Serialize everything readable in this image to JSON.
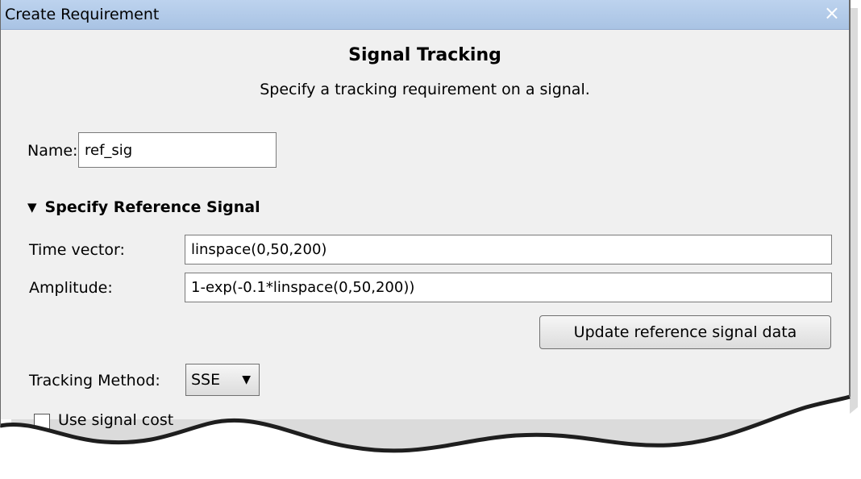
{
  "window": {
    "title": "Create Requirement",
    "close_glyph": "×"
  },
  "header": {
    "title": "Signal Tracking",
    "subtitle": "Specify a tracking requirement on a signal."
  },
  "name_field": {
    "label": "Name:",
    "value": "ref_sig"
  },
  "reference_signal": {
    "section_label": "Specify Reference Signal",
    "expanded_glyph": "▼",
    "time_vector": {
      "label": "Time vector:",
      "value": "linspace(0,50,200)"
    },
    "amplitude": {
      "label": "Amplitude:",
      "value": "1-exp(-0.1*linspace(0,50,200))"
    },
    "update_button": "Update reference signal data"
  },
  "tracking_method": {
    "label": "Tracking Method:",
    "value": "SSE",
    "arrow_glyph": "▼"
  },
  "partial_option": {
    "label": "Use signal cost"
  }
}
